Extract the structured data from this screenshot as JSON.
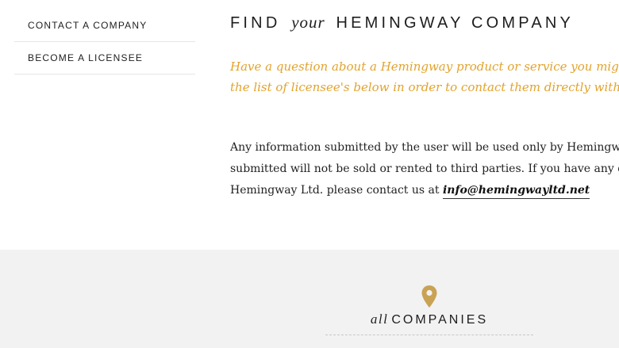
{
  "sidebar": {
    "items": [
      {
        "label": "CONTACT A COMPANY"
      },
      {
        "label": "BECOME A LICENSEE"
      }
    ]
  },
  "header": {
    "title_prefix": "FIND",
    "title_italic": "your",
    "title_suffix": "HEMINGWAY COMPANY"
  },
  "intro": {
    "line1": "Have a question about a Hemingway product or service you might have",
    "line2": "the list of licensee's below in order to contact them directly with your"
  },
  "body": {
    "line1": "Any information submitted by the user will be used only by Hemingway",
    "line2": "submitted will not be sold or rented to third parties. If you have any ques",
    "line3_text": "Hemingway Ltd. please contact us at ",
    "email": "info@hemingwayltd.net"
  },
  "companies": {
    "title_italic": "all",
    "title": "COMPANIES",
    "icon": "map-pin-icon"
  },
  "colors": {
    "accent": "#e2a32d",
    "pin": "#c9a253",
    "footer_bg": "#f2f2f2"
  }
}
